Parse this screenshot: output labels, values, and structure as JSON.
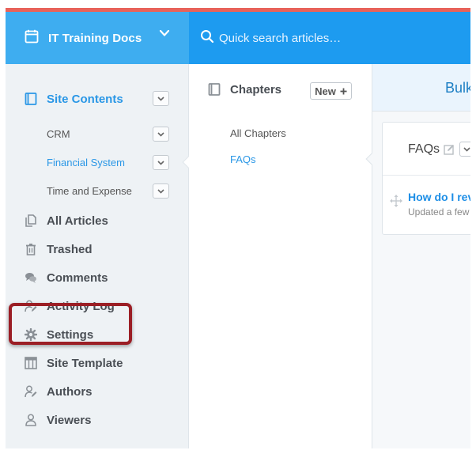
{
  "header": {
    "site_title": "IT Training Docs",
    "search_placeholder": "Quick search articles…"
  },
  "sidebar": {
    "site_contents": "Site Contents",
    "sub_items": [
      {
        "label": "CRM"
      },
      {
        "label": "Financial System"
      },
      {
        "label": "Time and Expense"
      }
    ],
    "items": [
      {
        "label": "All Articles"
      },
      {
        "label": "Trashed"
      },
      {
        "label": "Comments"
      },
      {
        "label": "Activity Log"
      },
      {
        "label": "Settings"
      },
      {
        "label": "Site Template"
      },
      {
        "label": "Authors"
      },
      {
        "label": "Viewers"
      }
    ]
  },
  "chapters": {
    "title": "Chapters",
    "new_label": "New",
    "items": [
      {
        "label": "All Chapters"
      },
      {
        "label": "FAQs"
      }
    ]
  },
  "main": {
    "bulk_label": "Bulk",
    "card_title": "FAQs",
    "article_title": "How do I rev",
    "article_updated": "Updated a few"
  },
  "colors": {
    "header_left": "#3eadf0",
    "header_right": "#1d9bf0",
    "accent": "#2a97e6",
    "top_stripe": "#e8625a",
    "highlight_border": "#9b1e25",
    "sidebar_bg": "#eef2f5"
  },
  "icons": {
    "site": "calendar-icon",
    "search": "search-icon",
    "site_contents": "book-icon",
    "all_articles": "copy-icon",
    "trashed": "trash-icon",
    "comments": "comments-icon",
    "activity_log": "user-edit-icon",
    "settings": "gear-icon",
    "site_template": "template-icon",
    "authors": "user-edit-icon",
    "viewers": "user-icon"
  }
}
